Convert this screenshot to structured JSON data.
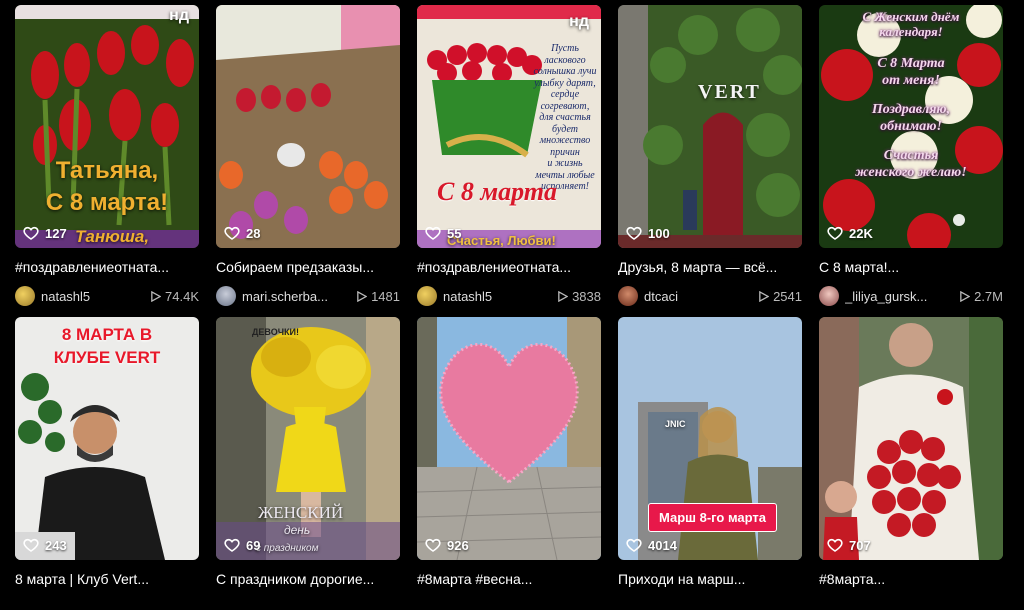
{
  "cards": [
    {
      "title": "#поздравлениеотната...",
      "likes": "127",
      "author": "natashl5",
      "plays": "74.4K",
      "overlay_top": "нд",
      "overlay_lines": [
        "Татьяна,",
        "С 8 марта!",
        "Танюша,"
      ],
      "colors": {
        "bg1": "#3b5a1a",
        "bg2": "#b8121b",
        "avatar": "#c9a43a"
      }
    },
    {
      "title": "Собираем предзаказы...",
      "likes": "28",
      "author": "mari.scherba...",
      "plays": "1481",
      "colors": {
        "bg1": "#6b5a45",
        "bg2": "#d8652a",
        "avatar": "#8a96a8"
      }
    },
    {
      "title": "#поздравлениеотната...",
      "likes": "55",
      "author": "natashl5",
      "plays": "3838",
      "overlay_top": "нд",
      "overlay_lines": [
        "Пусть",
        "ласкового",
        "солнышка лучи",
        "улыбку дарят,",
        "сердце",
        "согревают,",
        "для счастья",
        "будет",
        "множество",
        "причин",
        "и жизнь",
        "мечты любые",
        "исполняет!",
        "С 8 марта",
        "Счастья, Любви!"
      ],
      "colors": {
        "bg1": "#e7e2d8",
        "bg2": "#c8102e",
        "avatar": "#c9a43a"
      }
    },
    {
      "title": "Друзья, 8 марта — всё...",
      "likes": "100",
      "author": "dtcaci",
      "plays": "2541",
      "overlay_top": "VERT",
      "colors": {
        "bg1": "#3a4d2a",
        "bg2": "#7a1520",
        "avatar": "#a4553b"
      }
    },
    {
      "title": "С 8 марта!...",
      "likes": "22K",
      "author": "_liliya_gursk...",
      "plays": "2.7M",
      "overlay_lines": [
        "С Женским днём",
        "календаря!",
        "С 8 Марта",
        "от меня!",
        "Поздравляю,",
        "обнимаю!",
        "Счастья",
        "женского желаю!"
      ],
      "colors": {
        "bg1": "#1e3a14",
        "bg2": "#c81420",
        "avatar": "#d8a8a0"
      }
    },
    {
      "title": "8 марта | Клуб Vert...",
      "likes": "243",
      "author": "",
      "plays": "",
      "overlay_lines": [
        "8 МАРТА В",
        "КЛУБЕ VERT"
      ],
      "colors": {
        "bg1": "#e8e8e8",
        "bg2": "#1a1a1a",
        "avatar": "#999"
      }
    },
    {
      "title": "С праздником дорогие...",
      "likes": "69",
      "author": "",
      "plays": "",
      "overlay_lines": [
        "ДЕВОЧКИ!",
        "ЖЕНСКИЙ",
        "день",
        "с праздником"
      ],
      "colors": {
        "bg1": "#9a9a8a",
        "bg2": "#e8c81a",
        "avatar": "#999"
      }
    },
    {
      "title": "#8марта #весна...",
      "likes": "926",
      "author": "",
      "plays": "",
      "colors": {
        "bg1": "#8ab4d8",
        "bg2": "#e87aa0",
        "avatar": "#999"
      }
    },
    {
      "title": "Приходи на марш...",
      "likes": "4014",
      "author": "",
      "plays": "",
      "overlay_top": "JNIC",
      "overlay_lines": [
        "Марш 8-го марта"
      ],
      "colors": {
        "bg1": "#a8c4e0",
        "bg2": "#6a6a3a",
        "avatar": "#999"
      }
    },
    {
      "title": "#8марта...",
      "likes": "707",
      "author": "",
      "plays": "",
      "colors": {
        "bg1": "#6a7a5a",
        "bg2": "#c41a24",
        "avatar": "#999"
      }
    }
  ]
}
